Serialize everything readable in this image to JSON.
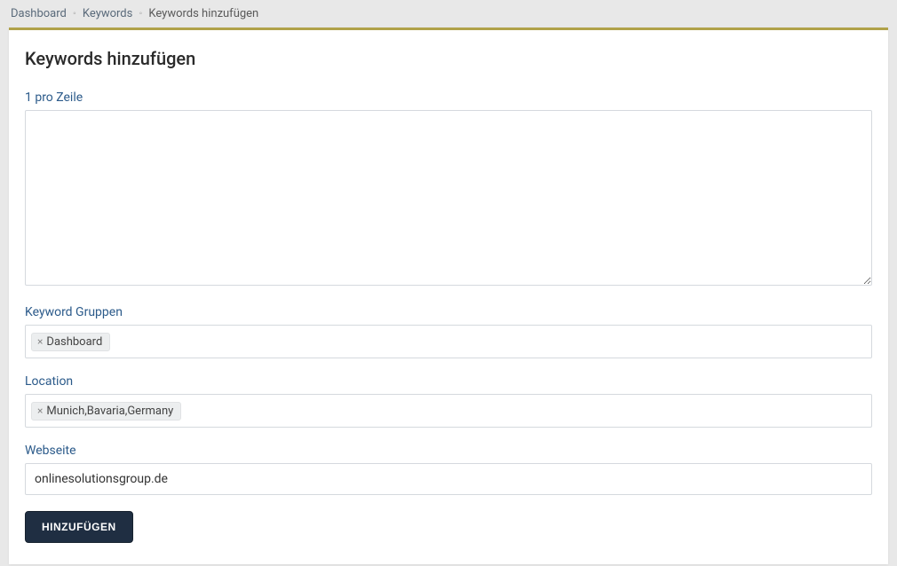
{
  "breadcrumb": {
    "items": [
      {
        "label": "Dashboard"
      },
      {
        "label": "Keywords"
      },
      {
        "label": "Keywords hinzufügen"
      }
    ]
  },
  "page": {
    "title": "Keywords hinzufügen"
  },
  "form": {
    "keywords": {
      "label": "1 pro Zeile",
      "value": ""
    },
    "groups": {
      "label": "Keyword Gruppen",
      "tags": [
        {
          "label": "Dashboard"
        }
      ]
    },
    "location": {
      "label": "Location",
      "tags": [
        {
          "label": "Munich,Bavaria,Germany"
        }
      ]
    },
    "website": {
      "label": "Webseite",
      "value": "onlinesolutionsgroup.de"
    },
    "submit": {
      "label": "HINZUFÜGEN"
    }
  }
}
